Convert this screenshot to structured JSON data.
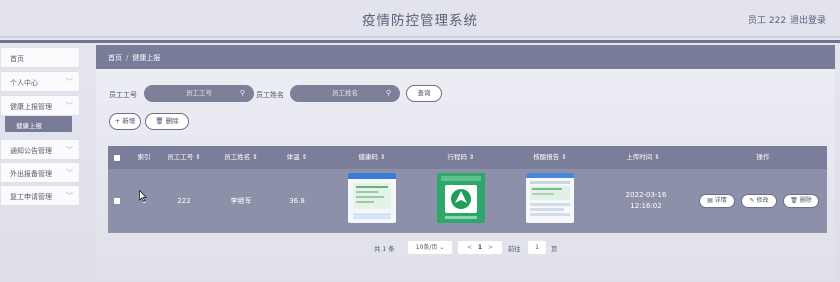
{
  "header": {
    "title": "疫情防控管理系统",
    "user": "员工 222",
    "logout": "退出登录"
  },
  "sidebar": {
    "items": [
      {
        "label": "首页"
      },
      {
        "label": "个人中心",
        "chevron": "﹀"
      },
      {
        "label": "健康上报管理",
        "chevron": "﹀"
      },
      {
        "label": "健康上报"
      },
      {
        "label": "通知公告管理",
        "chevron": "﹀"
      },
      {
        "label": "外出报备管理",
        "chevron": "﹀"
      },
      {
        "label": "复工申请管理",
        "chevron": "﹀"
      }
    ]
  },
  "breadcrumb": {
    "home": "首页",
    "sep": "/",
    "current": "健康上报"
  },
  "search": {
    "id_label": "员工工号",
    "id_placeholder": "员工工号",
    "name_label": "员工姓名",
    "name_placeholder": "员工姓名",
    "query_button": "查询"
  },
  "actions": {
    "add": "+ 新增",
    "delete": "🗑 删除"
  },
  "table": {
    "headers": [
      "索引",
      "员工工号 ⇕",
      "员工姓名 ⇕",
      "体温 ⇕",
      "健康码 ⇕",
      "行程码 ⇕",
      "核酸报告 ⇕",
      "上传时间 ⇕",
      "操作"
    ],
    "rows": [
      {
        "index": "1",
        "emp_id": "222",
        "emp_name": "李继军",
        "temperature": "36.8",
        "upload_time": "2022-03-16 12:16:02",
        "ops": {
          "detail": "详情",
          "edit": "修改",
          "delete": "删除"
        }
      }
    ]
  },
  "pagination": {
    "total": "共 1 条",
    "page_size": "10条/页",
    "prev": "<",
    "current": "1",
    "next": ">",
    "goto": "前往",
    "goto_value": "1",
    "page_unit": "页"
  },
  "icons": {
    "search": "magnifier-icon",
    "checkbox": "checkbox-icon",
    "cursor": "mouse-pointer-icon"
  },
  "colors": {
    "accent": "#787c98",
    "row": "#8d90a9",
    "input": "#7d8099"
  }
}
